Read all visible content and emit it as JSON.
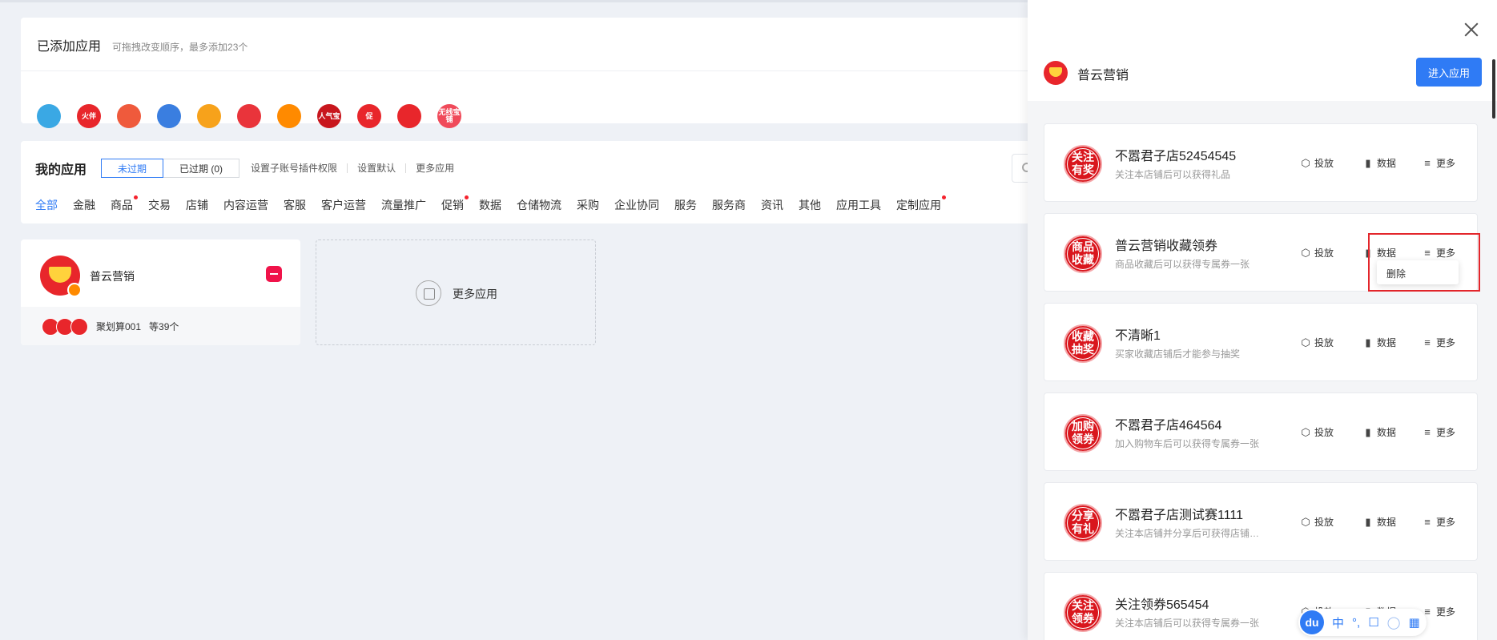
{
  "added_apps": {
    "title": "已添加应用",
    "hint": "可拖拽改变顺序，最多添加23个",
    "icons": [
      {
        "name": "app-icon-1",
        "label": "",
        "color": "#3aa8e4"
      },
      {
        "name": "app-icon-huoban",
        "label": "火伴",
        "color": "#e8262b"
      },
      {
        "name": "app-icon-3",
        "label": "",
        "color": "#ef5a3c"
      },
      {
        "name": "app-icon-4",
        "label": "",
        "color": "#3a7ee0"
      },
      {
        "name": "app-icon-5",
        "label": "",
        "color": "#f7a21b"
      },
      {
        "name": "app-icon-6",
        "label": "",
        "color": "#e9343b"
      },
      {
        "name": "app-icon-7",
        "label": "",
        "color": "#ff8a00"
      },
      {
        "name": "app-icon-renqibao",
        "label": "人气宝",
        "color": "#c8161d"
      },
      {
        "name": "app-icon-cu",
        "label": "促",
        "color": "#e8262b"
      },
      {
        "name": "app-icon-puyun",
        "label": "",
        "color": "#e8262b"
      },
      {
        "name": "app-icon-wuxianbaopu",
        "label": "无线宝铺",
        "color": "#f04a5a"
      }
    ]
  },
  "my_apps": {
    "title": "我的应用",
    "seg_active": "未过期",
    "seg_expired": "已过期 (0)",
    "links": [
      "设置子账号插件权限",
      "设置默认",
      "更多应用"
    ],
    "categories": [
      {
        "label": "全部",
        "active": true,
        "dot": false
      },
      {
        "label": "金融",
        "active": false,
        "dot": false
      },
      {
        "label": "商品",
        "active": false,
        "dot": true
      },
      {
        "label": "交易",
        "active": false,
        "dot": false
      },
      {
        "label": "店铺",
        "active": false,
        "dot": false
      },
      {
        "label": "内容运营",
        "active": false,
        "dot": false
      },
      {
        "label": "客服",
        "active": false,
        "dot": false
      },
      {
        "label": "客户运营",
        "active": false,
        "dot": false
      },
      {
        "label": "流量推广",
        "active": false,
        "dot": false
      },
      {
        "label": "促销",
        "active": false,
        "dot": true
      },
      {
        "label": "数据",
        "active": false,
        "dot": false
      },
      {
        "label": "仓储物流",
        "active": false,
        "dot": false
      },
      {
        "label": "采购",
        "active": false,
        "dot": false
      },
      {
        "label": "企业协同",
        "active": false,
        "dot": false
      },
      {
        "label": "服务",
        "active": false,
        "dot": false
      },
      {
        "label": "服务商",
        "active": false,
        "dot": false
      },
      {
        "label": "资讯",
        "active": false,
        "dot": false
      },
      {
        "label": "其他",
        "active": false,
        "dot": false
      },
      {
        "label": "应用工具",
        "active": false,
        "dot": false
      },
      {
        "label": "定制应用",
        "active": false,
        "dot": true
      }
    ]
  },
  "app_card": {
    "name": "普云营销",
    "footer_text": "聚划算001",
    "footer_count": "等39个"
  },
  "more_apps": {
    "label": "更多应用"
  },
  "drawer": {
    "title": "普云营销",
    "enter_label": "进入应用",
    "action_labels": {
      "deploy": "投放",
      "data": "数据",
      "more": "更多"
    },
    "menu_delete": "删除",
    "items": [
      {
        "seal": "关注有奖",
        "title": "不嚣君子店52454545",
        "desc": "关注本店铺后可以获得礼品"
      },
      {
        "seal": "商品收藏",
        "title": "普云营销收藏领券",
        "desc": "商品收藏后可以获得专属券一张"
      },
      {
        "seal": "收藏抽奖",
        "title": "不清晰1",
        "desc": "买家收藏店铺后才能参与抽奖"
      },
      {
        "seal": "加购领券",
        "title": "不嚣君子店464564",
        "desc": "加入购物车后可以获得专属券一张"
      },
      {
        "seal": "分享有礼",
        "title": "不嚣君子店测试赛1111",
        "desc": "关注本店铺并分享后可获得店铺提供..."
      },
      {
        "seal": "关注领券",
        "title": "关注领券565454",
        "desc": "关注本店铺后可以获得专属券一张"
      }
    ]
  },
  "ime": {
    "logo": "du",
    "lang": "中"
  },
  "colors": {
    "primary": "#2f7bf5",
    "brand_red": "#e8262b",
    "highlight": "#e3262b"
  }
}
